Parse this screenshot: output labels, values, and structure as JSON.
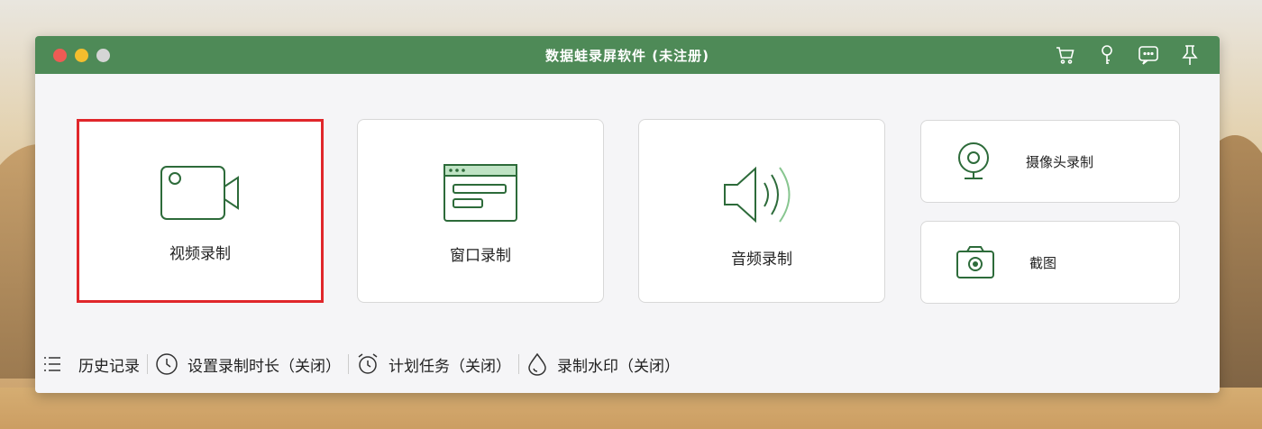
{
  "window": {
    "title": "数据蛙录屏软件 (未注册)"
  },
  "titlebar_icons": [
    "cart-icon",
    "key-icon",
    "chat-icon",
    "pin-icon"
  ],
  "cards": {
    "video": {
      "label": "视频录制",
      "icon": "video-camera-icon"
    },
    "window": {
      "label": "窗口录制",
      "icon": "window-icon"
    },
    "audio": {
      "label": "音频录制",
      "icon": "speaker-icon"
    },
    "webcam": {
      "label": "摄像头录制",
      "icon": "webcam-icon"
    },
    "screenshot": {
      "label": "截图",
      "icon": "camera-icon"
    }
  },
  "bottombar": {
    "history": "历史记录",
    "duration": "设置录制时长（关闭）",
    "schedule": "计划任务（关闭）",
    "watermark": "录制水印（关闭）"
  },
  "colors": {
    "accent": "#4e8a57",
    "icon_green": "#2d6b3a",
    "selection": "#e0272b"
  }
}
